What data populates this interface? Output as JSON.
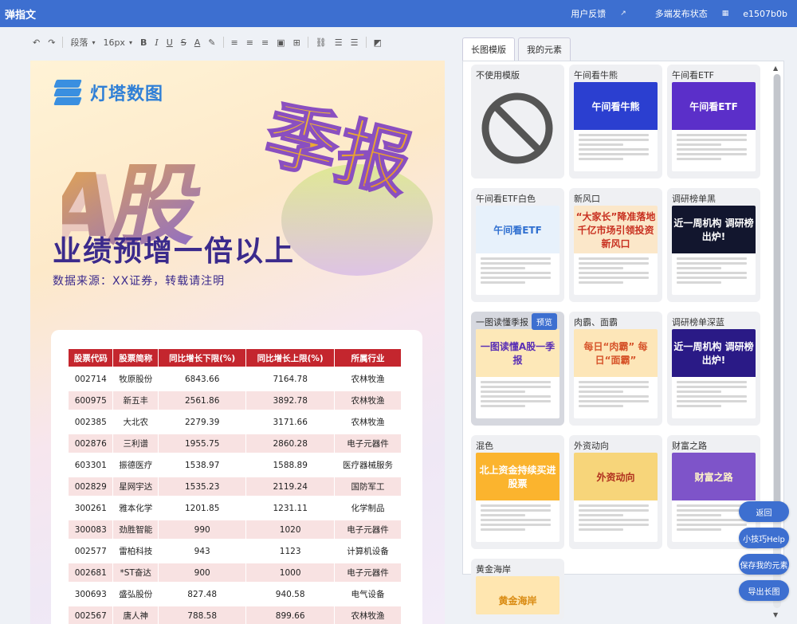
{
  "app": {
    "title": "弹指文"
  },
  "topbar": {
    "feedback": "用户反馈",
    "publish_status": "多端发布状态",
    "user_id": "e1507b0b"
  },
  "toolbar": {
    "paragraph": "段落",
    "font_size": "16px"
  },
  "doc": {
    "logo_text": "灯塔数图",
    "art_text_1": "A股",
    "art_text_2": "季报",
    "headline": "业绩预增一倍以上",
    "subhead": "数据来源：XX证券，转载请注明",
    "table": {
      "headers": [
        "股票代码",
        "股票简称",
        "同比增长下限(%)",
        "同比增长上限(%)",
        "所属行业"
      ],
      "rows": [
        [
          "002714",
          "牧原股份",
          "6843.66",
          "7164.78",
          "农林牧渔"
        ],
        [
          "600975",
          "新五丰",
          "2561.86",
          "3892.78",
          "农林牧渔"
        ],
        [
          "002385",
          "大北农",
          "2279.39",
          "3171.66",
          "农林牧渔"
        ],
        [
          "002876",
          "三利谱",
          "1955.75",
          "2860.28",
          "电子元器件"
        ],
        [
          "603301",
          "振德医疗",
          "1538.97",
          "1588.89",
          "医疗器械服务"
        ],
        [
          "002829",
          "星网宇达",
          "1535.23",
          "2119.24",
          "国防军工"
        ],
        [
          "300261",
          "雅本化学",
          "1201.85",
          "1231.11",
          "化学制品"
        ],
        [
          "300083",
          "劲胜智能",
          "990",
          "1020",
          "电子元器件"
        ],
        [
          "002577",
          "雷柏科技",
          "943",
          "1123",
          "计算机设备"
        ],
        [
          "002681",
          "*ST奋达",
          "900",
          "1000",
          "电子元器件"
        ],
        [
          "300693",
          "盛弘股份",
          "827.48",
          "940.58",
          "电气设备"
        ],
        [
          "002567",
          "唐人神",
          "788.58",
          "899.66",
          "农林牧渔"
        ]
      ]
    }
  },
  "panel": {
    "tabs": [
      "长图模版",
      "我的元素"
    ],
    "preview_label": "预览",
    "templates": [
      {
        "title": "不使用模版",
        "thumb": "",
        "color": "#ffffff",
        "text_color": "#333333"
      },
      {
        "title": "午间看牛熊",
        "thumb": "午间看牛熊",
        "color": "#2b3fd0",
        "text_color": "#ffffff"
      },
      {
        "title": "午间看ETF",
        "thumb": "午间看ETF",
        "color": "#5b2fc9",
        "text_color": "#ffffff"
      },
      {
        "title": "午间看ETF白色",
        "thumb": "午间看ETF",
        "color": "#e7f1fb",
        "text_color": "#2f6fd0"
      },
      {
        "title": "新风口",
        "thumb": "“大家长”降准落地 千亿市场引领投资新风口",
        "color": "#fbe7c9",
        "text_color": "#c83020"
      },
      {
        "title": "调研榜单黑",
        "thumb": "近一周机构 调研榜出炉!",
        "color": "#12162e",
        "text_color": "#ffffff"
      },
      {
        "title": "一图读懂季报",
        "thumb": "一图读懂A股一季报",
        "color": "#fde8b8",
        "text_color": "#5a2fb5"
      },
      {
        "title": "肉霸、面霸",
        "thumb": "每日“肉霸” 每日“面霸”",
        "color": "#fde6b8",
        "text_color": "#d6542a"
      },
      {
        "title": "调研榜单深蓝",
        "thumb": "近一周机构 调研榜出炉!",
        "color": "#2a1a86",
        "text_color": "#ffffff"
      },
      {
        "title": "混色",
        "thumb": "北上资金持续买进股票",
        "color": "#fbb42e",
        "text_color": "#ffffff"
      },
      {
        "title": "外资动向",
        "thumb": "外资动向",
        "color": "#f7d57a",
        "text_color": "#b0301e"
      },
      {
        "title": "财富之路",
        "thumb": "财富之路",
        "color": "#7e54c9",
        "text_color": "#fff5c8"
      },
      {
        "title": "黄金海岸",
        "thumb": "黄金海岸",
        "color": "#ffe6b0",
        "text_color": "#d98a10"
      }
    ]
  },
  "fabs": {
    "back": "返回",
    "help": "小技巧Help",
    "save": "保存我的元素",
    "export": "导出长图"
  },
  "colors": {
    "brand": "#3d6fd0",
    "table_header": "#c4262e",
    "table_alt": "#f8e2e2",
    "headline": "#3b2a8c"
  }
}
